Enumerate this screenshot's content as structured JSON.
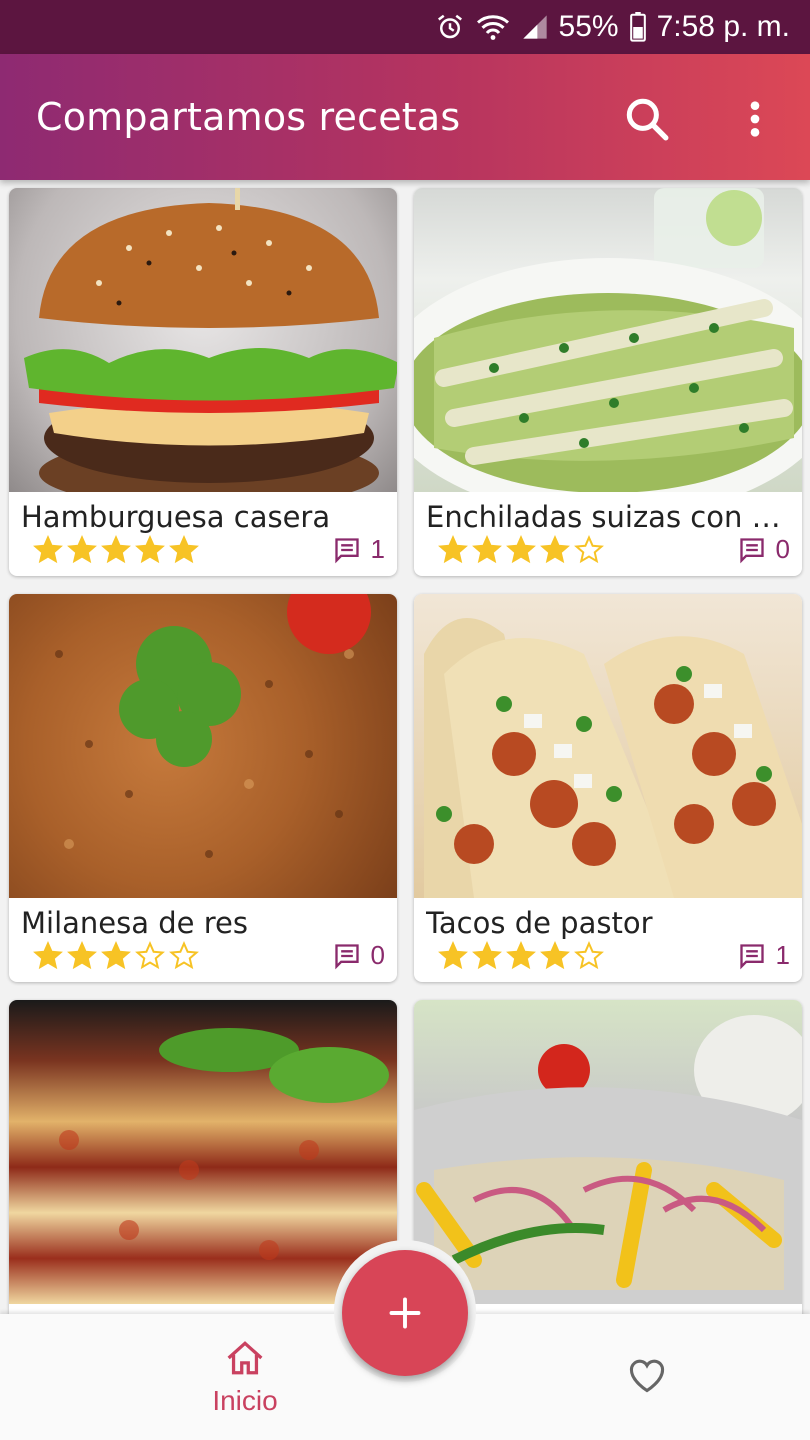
{
  "status_bar": {
    "battery": "55%",
    "time": "7:58 p. m."
  },
  "app_bar": {
    "title": "Compartamos recetas",
    "icons": [
      "search-icon",
      "more-vert-icon"
    ]
  },
  "recipes": [
    {
      "title": "Hamburguesa casera",
      "rating": 5,
      "comments": "1",
      "image": "burger"
    },
    {
      "title": "Enchiladas suizas con chi...",
      "rating": 4,
      "comments": "0",
      "image": "enchiladas"
    },
    {
      "title": "Milanesa de res",
      "rating": 3,
      "comments": "0",
      "image": "milanesa"
    },
    {
      "title": "Tacos de pastor",
      "rating": 4,
      "comments": "1",
      "image": "tacos"
    },
    {
      "title": "",
      "rating": 0,
      "comments": "",
      "image": "lasagna"
    },
    {
      "title": "",
      "rating": 0,
      "comments": "",
      "image": "foil-vegetables"
    }
  ],
  "bottom_nav": {
    "home_label": "Inicio",
    "fab_icon": "add-icon",
    "favorites_icon": "heart-icon"
  },
  "colors": {
    "accent": "#d84557",
    "star": "#f7c325",
    "comment": "#8a2a6c",
    "nav_active": "#c94160"
  }
}
